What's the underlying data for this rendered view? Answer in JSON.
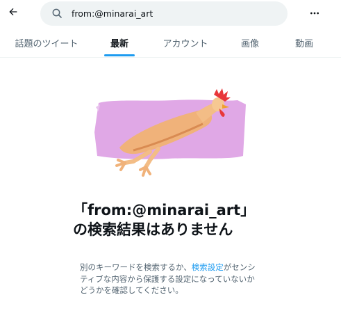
{
  "header": {
    "back_icon": "arrow-left-icon",
    "search": {
      "value": "from:@minarai_art",
      "icon": "search-icon"
    },
    "more_icon": "more-horizontal-icon"
  },
  "tabs": [
    {
      "label": "話題のツイート",
      "active": false
    },
    {
      "label": "最新",
      "active": true
    },
    {
      "label": "アカウント",
      "active": false
    },
    {
      "label": "画像",
      "active": false
    },
    {
      "label": "動画",
      "active": false
    }
  ],
  "empty_state": {
    "illustration": "rubber-chicken-image",
    "title": "「from:@minarai_art」の検索結果はありません",
    "desc_before": "別のキーワードを検索するか、",
    "desc_link": "検索設定",
    "desc_after": "がセンシティブな内容から保護する設定になっていないかどうかを確認してください。"
  },
  "colors": {
    "accent": "#1d9bf0",
    "secondary_text": "#536471",
    "search_bg": "#eff3f4",
    "illustration_bg": "#e0a8e6"
  }
}
